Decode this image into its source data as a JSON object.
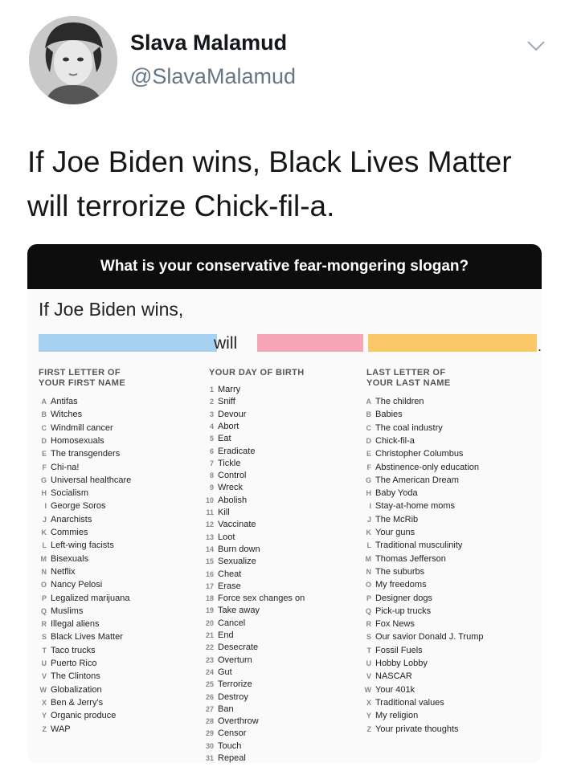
{
  "tweet": {
    "author_name": "Slava Malamud",
    "author_handle": "@SlavaMalamud",
    "text": "If Joe Biden wins, Black Lives Matter will terrorize Chick-fil-a."
  },
  "card": {
    "banner": "What is your conservative fear-mongering slogan?",
    "lead": "If Joe Biden wins,",
    "will": "will",
    "period": ".",
    "colors": {
      "blue": "#a6d1f1",
      "pink": "#f7a6b8",
      "yellow": "#fbc96a"
    },
    "columns": [
      {
        "head": [
          "FIRST LETTER OF",
          "YOUR FIRST NAME"
        ],
        "rows": [
          [
            "A",
            "Antifas"
          ],
          [
            "B",
            "Witches"
          ],
          [
            "C",
            "Windmill cancer"
          ],
          [
            "D",
            "Homosexuals"
          ],
          [
            "E",
            "The transgenders"
          ],
          [
            "F",
            "Chi-na!"
          ],
          [
            "G",
            "Universal healthcare"
          ],
          [
            "H",
            "Socialism"
          ],
          [
            "I",
            "George Soros"
          ],
          [
            "J",
            "Anarchists"
          ],
          [
            "K",
            "Commies"
          ],
          [
            "L",
            "Left-wing facists"
          ],
          [
            "M",
            "Bisexuals"
          ],
          [
            "N",
            "Netflix"
          ],
          [
            "O",
            "Nancy Pelosi"
          ],
          [
            "P",
            "Legalized marijuana"
          ],
          [
            "Q",
            "Muslims"
          ],
          [
            "R",
            "Illegal aliens"
          ],
          [
            "S",
            "Black Lives Matter"
          ],
          [
            "T",
            "Taco trucks"
          ],
          [
            "U",
            "Puerto Rico"
          ],
          [
            "V",
            "The Clintons"
          ],
          [
            "W",
            "Globalization"
          ],
          [
            "X",
            "Ben & Jerry's"
          ],
          [
            "Y",
            "Organic produce"
          ],
          [
            "Z",
            "WAP"
          ]
        ]
      },
      {
        "head": [
          "YOUR DAY OF BIRTH"
        ],
        "rows": [
          [
            "1",
            "Marry"
          ],
          [
            "2",
            "Sniff"
          ],
          [
            "3",
            "Devour"
          ],
          [
            "4",
            "Abort"
          ],
          [
            "5",
            "Eat"
          ],
          [
            "6",
            "Eradicate"
          ],
          [
            "7",
            "Tickle"
          ],
          [
            "8",
            "Control"
          ],
          [
            "9",
            "Wreck"
          ],
          [
            "10",
            "Abolish"
          ],
          [
            "11",
            "Kill"
          ],
          [
            "12",
            "Vaccinate"
          ],
          [
            "13",
            "Loot"
          ],
          [
            "14",
            "Burn down"
          ],
          [
            "15",
            "Sexualize"
          ],
          [
            "16",
            "Cheat"
          ],
          [
            "17",
            "Erase"
          ],
          [
            "18",
            "Force sex changes on"
          ],
          [
            "19",
            "Take away"
          ],
          [
            "20",
            "Cancel"
          ],
          [
            "21",
            "End"
          ],
          [
            "22",
            "Desecrate"
          ],
          [
            "23",
            "Overturn"
          ],
          [
            "24",
            "Gut"
          ],
          [
            "25",
            "Terrorize"
          ],
          [
            "26",
            "Destroy"
          ],
          [
            "27",
            "Ban"
          ],
          [
            "28",
            "Overthrow"
          ],
          [
            "29",
            "Censor"
          ],
          [
            "30",
            "Touch"
          ],
          [
            "31",
            "Repeal"
          ]
        ]
      },
      {
        "head": [
          "LAST LETTER OF",
          "YOUR LAST NAME"
        ],
        "rows": [
          [
            "A",
            "The children"
          ],
          [
            "B",
            "Babies"
          ],
          [
            "C",
            "The coal industry"
          ],
          [
            "D",
            "Chick-fil-a"
          ],
          [
            "E",
            "Christopher Columbus"
          ],
          [
            "F",
            "Abstinence-only education"
          ],
          [
            "G",
            "The American Dream"
          ],
          [
            "H",
            "Baby Yoda"
          ],
          [
            "I",
            "Stay-at-home moms"
          ],
          [
            "J",
            "The McRib"
          ],
          [
            "K",
            "Your guns"
          ],
          [
            "L",
            "Traditional musculinity"
          ],
          [
            "M",
            "Thomas Jefferson"
          ],
          [
            "N",
            "The suburbs"
          ],
          [
            "O",
            "My freedoms"
          ],
          [
            "P",
            "Designer dogs"
          ],
          [
            "Q",
            "Pick-up trucks"
          ],
          [
            "R",
            "Fox News"
          ],
          [
            "S",
            "Our savior Donald J. Trump"
          ],
          [
            "T",
            "Fossil Fuels"
          ],
          [
            "U",
            "Hobby Lobby"
          ],
          [
            "V",
            "NASCAR"
          ],
          [
            "W",
            "Your 401k"
          ],
          [
            "X",
            "Traditional values"
          ],
          [
            "Y",
            "My religion"
          ],
          [
            "Z",
            "Your private thoughts"
          ]
        ]
      }
    ]
  }
}
